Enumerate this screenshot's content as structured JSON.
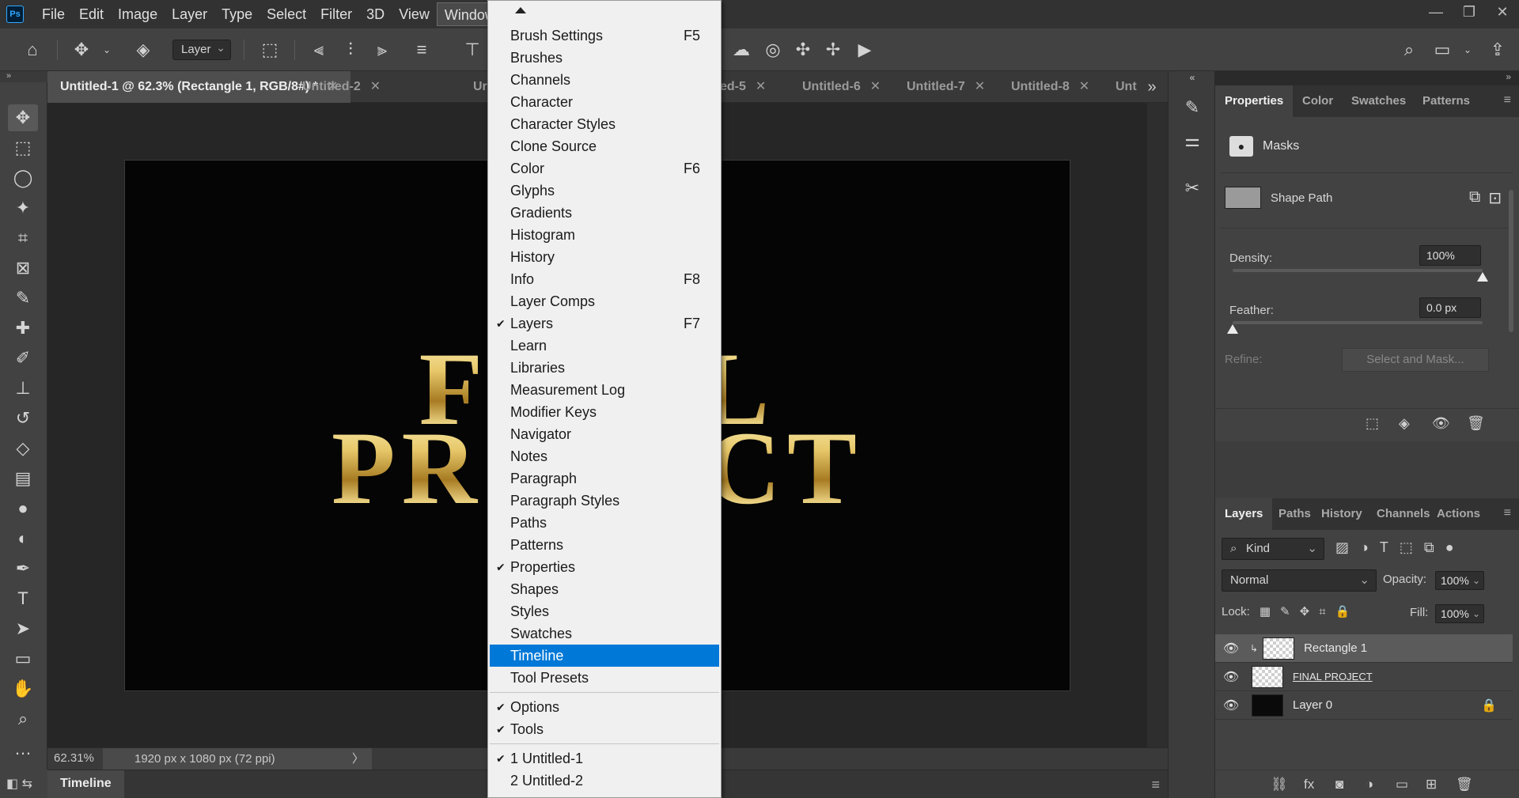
{
  "app": {
    "logo": "Ps"
  },
  "menubar": {
    "items": [
      "File",
      "Edit",
      "Image",
      "Layer",
      "Type",
      "Select",
      "Filter",
      "3D",
      "View",
      "Window"
    ],
    "active": "Window"
  },
  "window_controls": {
    "minimize": "—",
    "restore": "❐",
    "close": "✕"
  },
  "options": {
    "layer_select": "Layer"
  },
  "tabs": [
    {
      "label": "Untitled-1 @ 62.3% (Rectangle 1, RGB/8#) *",
      "active": true
    },
    {
      "label": "Untitled-2"
    },
    {
      "label": "Ur"
    },
    {
      "label": "ed-5"
    },
    {
      "label": "Untitled-6"
    },
    {
      "label": "Untitled-7"
    },
    {
      "label": "Untitled-8"
    },
    {
      "label": "Unt"
    }
  ],
  "canvas": {
    "line1": "FINAL",
    "line2": "PROJECT"
  },
  "status": {
    "zoom": "62.31%",
    "doc_size": "1920 px x 1080 px (72 ppi)",
    "arrow": "〉"
  },
  "timeline": {
    "label": "Timeline"
  },
  "window_menu": {
    "items": [
      {
        "label": "Brush Settings",
        "shortcut": "F5"
      },
      {
        "label": "Brushes"
      },
      {
        "label": "Channels"
      },
      {
        "label": "Character"
      },
      {
        "label": "Character Styles"
      },
      {
        "label": "Clone Source"
      },
      {
        "label": "Color",
        "shortcut": "F6"
      },
      {
        "label": "Glyphs"
      },
      {
        "label": "Gradients"
      },
      {
        "label": "Histogram"
      },
      {
        "label": "History"
      },
      {
        "label": "Info",
        "shortcut": "F8"
      },
      {
        "label": "Layer Comps"
      },
      {
        "label": "Layers",
        "shortcut": "F7",
        "checked": true
      },
      {
        "label": "Learn"
      },
      {
        "label": "Libraries"
      },
      {
        "label": "Measurement Log"
      },
      {
        "label": "Modifier Keys"
      },
      {
        "label": "Navigator"
      },
      {
        "label": "Notes"
      },
      {
        "label": "Paragraph"
      },
      {
        "label": "Paragraph Styles"
      },
      {
        "label": "Paths"
      },
      {
        "label": "Patterns"
      },
      {
        "label": "Properties",
        "checked": true
      },
      {
        "label": "Shapes"
      },
      {
        "label": "Styles"
      },
      {
        "label": "Swatches"
      },
      {
        "label": "Timeline",
        "highlighted": true
      },
      {
        "label": "Tool Presets"
      },
      {
        "label": "Options",
        "checked": true
      },
      {
        "label": "Tools",
        "checked": true
      },
      {
        "label": "1 Untitled-1",
        "checked": true
      },
      {
        "label": "2 Untitled-2"
      }
    ],
    "check_glyph": "✔",
    "highlight_color": "#0078d7"
  },
  "properties_panel": {
    "tabs": [
      "Properties",
      "Color",
      "Swatches",
      "Patterns"
    ],
    "masks_label": "Masks",
    "shape_path": "Shape Path",
    "density_label": "Density:",
    "density_value": "100%",
    "density": 1.0,
    "feather_label": "Feather:",
    "feather_value": "0.0 px",
    "feather": 0.0,
    "refine_label": "Refine:",
    "select_and_mask": "Select and Mask..."
  },
  "layers_panel": {
    "tabs": [
      "Layers",
      "Paths",
      "History",
      "Channels",
      "Actions"
    ],
    "kind": "Kind",
    "blend_mode": "Normal",
    "opacity_label": "Opacity:",
    "opacity_value": "100%",
    "lock_label": "Lock:",
    "fill_label": "Fill:",
    "fill_value": "100%",
    "layers": [
      {
        "name": "Rectangle 1",
        "selected": true
      },
      {
        "name": "FINAL PROJECT"
      },
      {
        "name": "Layer 0",
        "locked": true
      }
    ]
  },
  "colors": {
    "accent": "#0078d7",
    "background": "#262626",
    "panel": "#424242"
  }
}
